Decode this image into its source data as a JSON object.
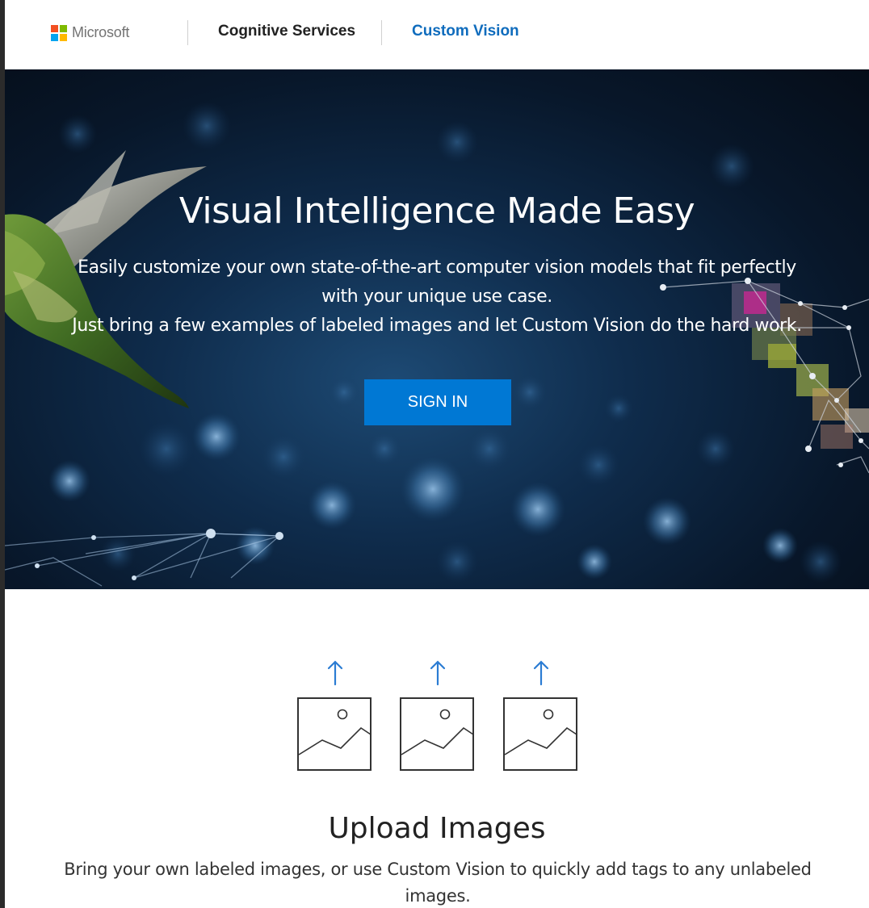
{
  "header": {
    "brand": "Microsoft",
    "nav": [
      {
        "label": "Cognitive Services",
        "color": "#222222"
      },
      {
        "label": "Custom Vision",
        "color": "#0f6cbd"
      }
    ],
    "logo_colors": [
      "#f25022",
      "#7fba00",
      "#00a4ef",
      "#ffb900"
    ]
  },
  "hero": {
    "title": "Visual Intelligence Made Easy",
    "description_lines": [
      "Easily customize your own state-of-the-art computer vision models that fit perfectly",
      "with your unique use case.",
      "Just bring a few examples of labeled images and let Custom Vision do the hard work."
    ],
    "signin_label": "SIGN IN",
    "button_color": "#0078d4"
  },
  "feature": {
    "icon_name": "upload-image-icon",
    "arrow_color": "#2b7cd3",
    "title": "Upload Images",
    "description": "Bring your own labeled images, or use Custom Vision to quickly add tags to any unlabeled images."
  }
}
